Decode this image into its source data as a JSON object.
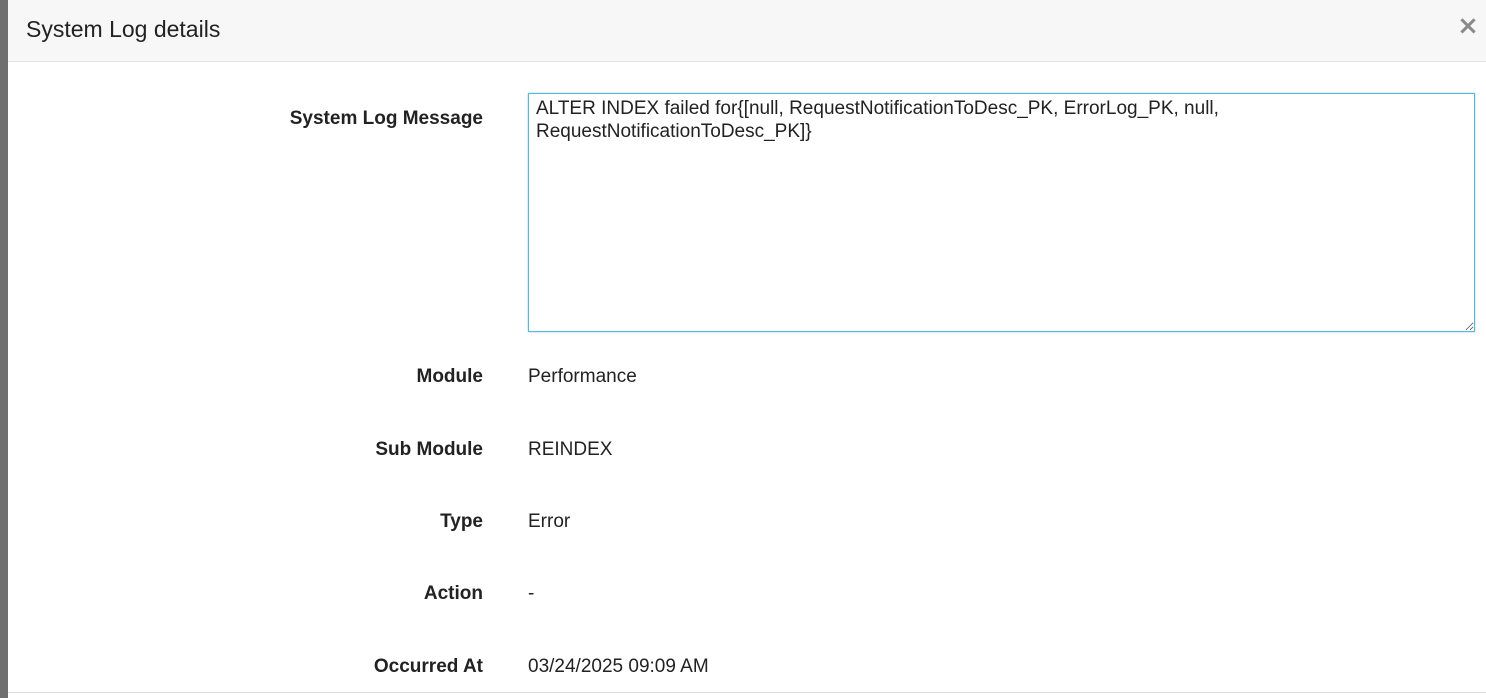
{
  "dialog": {
    "title": "System Log details",
    "close_symbol": "×"
  },
  "fields": {
    "message_label": "System Log Message",
    "message_value": "ALTER INDEX failed for{[null, RequestNotificationToDesc_PK, ErrorLog_PK, null, RequestNotificationToDesc_PK]}",
    "module_label": "Module",
    "module_value": "Performance",
    "submodule_label": "Sub Module",
    "submodule_value": "REINDEX",
    "type_label": "Type",
    "type_value": "Error",
    "action_label": "Action",
    "action_value": "-",
    "occurred_label": "Occurred At",
    "occurred_value": "03/24/2025 09:09 AM"
  },
  "colors": {
    "header_bg": "#f7f7f7",
    "input_border": "#5bb7d9",
    "text": "#222222"
  }
}
